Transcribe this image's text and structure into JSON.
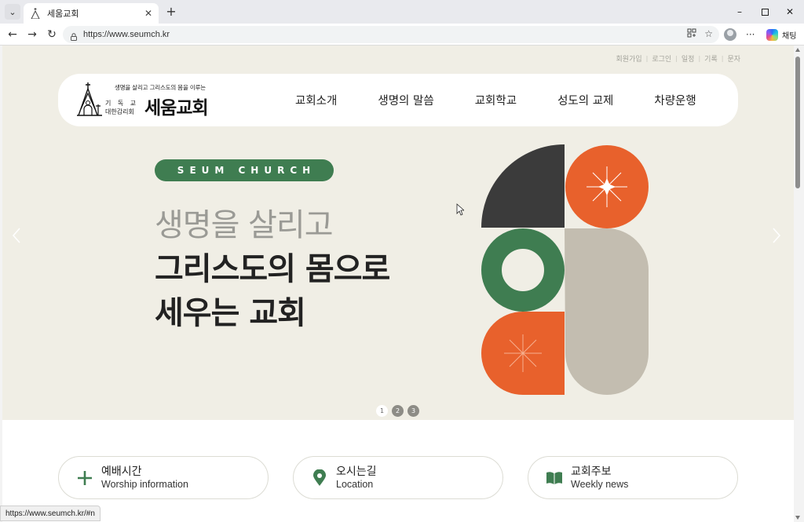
{
  "browser": {
    "tab_title": "세움교회",
    "url": "https://www.seumch.kr",
    "chat_label": "채팅",
    "status_url": "https://www.seumch.kr/#n"
  },
  "site": {
    "utility_links": [
      "회원가입",
      "로그인",
      "일정",
      "기록",
      "문자"
    ],
    "logo": {
      "tagline": "생명을 살리고 그리스도의 몸을 이루는",
      "sub1": "기 독 교",
      "sub2": "대한감리회",
      "name": "세움교회"
    },
    "menu": [
      "교회소개",
      "생명의 말씀",
      "교회학교",
      "성도의 교제",
      "차량운행"
    ],
    "hero": {
      "pill": "SEUM CHURCH",
      "line1": "생명을 살리고",
      "line2": "그리스도의 몸으로",
      "line3": "세우는 교회"
    },
    "slider_dots": [
      "1",
      "2",
      "3"
    ],
    "active_dot": 1,
    "quick_links": [
      {
        "ko": "예배시간",
        "en": "Worship information",
        "icon": "plus-icon"
      },
      {
        "ko": "오시는길",
        "en": "Location",
        "icon": "location-pin-icon"
      },
      {
        "ko": "교회주보",
        "en": "Weekly news",
        "icon": "book-icon"
      }
    ]
  },
  "colors": {
    "brand_green": "#3f7d51",
    "accent_orange": "#e8612c",
    "hero_bg": "#f0eee5",
    "dark_gray": "#3b3b3b",
    "beige": "#c3bdb0"
  }
}
